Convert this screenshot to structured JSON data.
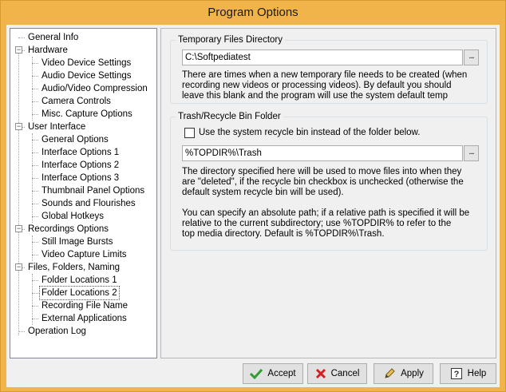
{
  "window": {
    "title": "Program Options"
  },
  "tree": {
    "items": [
      {
        "label": "General Info",
        "level": 0,
        "expander": ""
      },
      {
        "label": "Hardware",
        "level": 0,
        "expander": "-"
      },
      {
        "label": "Video Device Settings",
        "level": 1
      },
      {
        "label": "Audio Device Settings",
        "level": 1
      },
      {
        "label": "Audio/Video Compression",
        "level": 1
      },
      {
        "label": "Camera Controls",
        "level": 1
      },
      {
        "label": "Misc. Capture Options",
        "level": 1
      },
      {
        "label": "User Interface",
        "level": 0,
        "expander": "-"
      },
      {
        "label": "General Options",
        "level": 1
      },
      {
        "label": "Interface Options 1",
        "level": 1
      },
      {
        "label": "Interface Options 2",
        "level": 1
      },
      {
        "label": "Interface Options 3",
        "level": 1
      },
      {
        "label": "Thumbnail Panel Options",
        "level": 1
      },
      {
        "label": "Sounds and Flourishes",
        "level": 1
      },
      {
        "label": "Global Hotkeys",
        "level": 1
      },
      {
        "label": "Recordings Options",
        "level": 0,
        "expander": "-"
      },
      {
        "label": "Still Image Bursts",
        "level": 1
      },
      {
        "label": "Video Capture Limits",
        "level": 1
      },
      {
        "label": "Files, Folders, Naming",
        "level": 0,
        "expander": "-"
      },
      {
        "label": "Folder Locations 1",
        "level": 1
      },
      {
        "label": "Folder Locations 2",
        "level": 1,
        "selected": true
      },
      {
        "label": "Recording File Name",
        "level": 1
      },
      {
        "label": "External Applications",
        "level": 1
      },
      {
        "label": "Operation Log",
        "level": 0,
        "expander": ""
      }
    ]
  },
  "temp_dir": {
    "label": "Temporary Files Directory",
    "value": "C:\\Softpediatest",
    "browse_label": "...",
    "description": [
      "There are times when a new temporary file needs to be created (when",
      "recording new videos or processing videos).  By default you should",
      "leave this blank and the program will use the system default temp"
    ]
  },
  "trash": {
    "label": "Trash/Recycle Bin Folder",
    "checkbox_label": "Use the system recycle bin instead of the folder below.",
    "checked": false,
    "value": "%TOPDIR%\\Trash",
    "browse_label": "...",
    "description": [
      "The directory specified here will be used to move files into when they",
      "are \"deleted\", if the recycle bin checkbox is unchecked (otherwise the",
      "default system recycle bin will be used).",
      "",
      "You can specify an absolute path; if a relative path is specified it will be",
      "relative to the current subdirectory; use %TOPDIR% to refer to the",
      "top media directory.  Default is %TOPDIR%\\Trash."
    ]
  },
  "buttons": {
    "accept": "Accept",
    "cancel": "Cancel",
    "apply": "Apply",
    "help": "Help"
  },
  "colors": {
    "title_bar": "#f0b44a",
    "accept_icon": "#2e9e2e",
    "cancel_icon": "#d42020"
  }
}
